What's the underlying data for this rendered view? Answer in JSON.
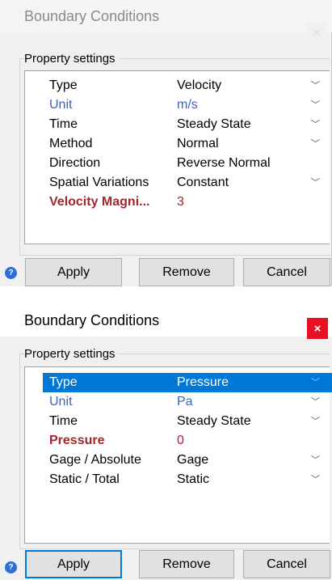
{
  "dialogs": [
    {
      "title": "Boundary Conditions",
      "close_icon": "×",
      "group_label": "Property settings",
      "rows": [
        {
          "name": "Type",
          "value": "Velocity",
          "dropdown": true
        },
        {
          "name": "Unit",
          "value": "m/s",
          "dropdown": true
        },
        {
          "name": "Time",
          "value": "Steady State",
          "dropdown": true
        },
        {
          "name": "Method",
          "value": "Normal",
          "dropdown": true
        },
        {
          "name": "Direction",
          "value": "Reverse Normal",
          "dropdown": false
        },
        {
          "name": "Spatial Variations",
          "value": "Constant",
          "dropdown": true
        },
        {
          "name": "Velocity Magni...",
          "value": "3",
          "dropdown": false
        }
      ],
      "buttons": {
        "apply": "Apply",
        "remove": "Remove",
        "cancel": "Cancel"
      }
    },
    {
      "title": "Boundary Conditions",
      "close_icon": "×",
      "group_label": "Property settings",
      "rows": [
        {
          "name": "Type",
          "value": "Pressure",
          "dropdown": true
        },
        {
          "name": "Unit",
          "value": "Pa",
          "dropdown": true
        },
        {
          "name": "Time",
          "value": "Steady State",
          "dropdown": true
        },
        {
          "name": "Pressure",
          "value": "0",
          "dropdown": false
        },
        {
          "name": "Gage / Absolute",
          "value": "Gage",
          "dropdown": true
        },
        {
          "name": "Static / Total",
          "value": "Static",
          "dropdown": true
        }
      ],
      "buttons": {
        "apply": "Apply",
        "remove": "Remove",
        "cancel": "Cancel"
      }
    }
  ],
  "icons": {
    "help": "?",
    "chevron": "﹀"
  },
  "colors": {
    "selection": "#0078d7",
    "required_label": "#a2262c",
    "unit_label": "#3b63b8",
    "close_active": "#e81123"
  }
}
